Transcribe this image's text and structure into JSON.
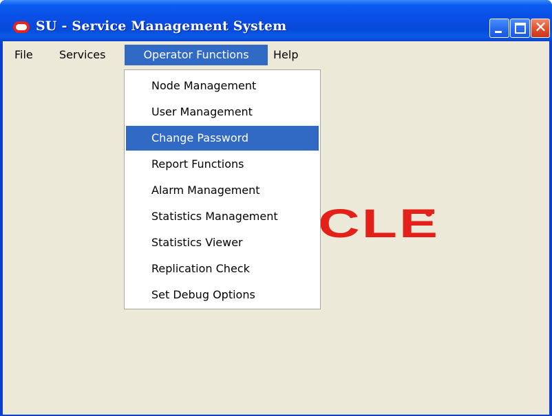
{
  "window": {
    "title": "SU - Service Management System",
    "controls": {
      "minimize_icon": "minimize-icon",
      "maximize_icon": "maximize-icon",
      "close_glyph": "✕"
    }
  },
  "menubar": {
    "items": [
      {
        "label": "File"
      },
      {
        "label": "Services"
      },
      {
        "label": "Operator Functions"
      },
      {
        "label": "Help"
      }
    ]
  },
  "dropdown": {
    "parent": "Operator Functions",
    "selected": "Change Password",
    "items": [
      {
        "label": "Node Management"
      },
      {
        "label": "User Management"
      },
      {
        "label": "Change Password"
      },
      {
        "label": "Report Functions"
      },
      {
        "label": "Alarm Management"
      },
      {
        "label": "Statistics Management"
      },
      {
        "label": "Statistics Viewer"
      },
      {
        "label": "Replication Check"
      },
      {
        "label": "Set Debug Options"
      }
    ]
  },
  "background_logo": {
    "visible_text": "CLE"
  },
  "colors": {
    "titlebar": "#0a4ee4",
    "menu_highlight": "#316ac5",
    "client_bg": "#ece9d8",
    "logo_red": "#e3201a"
  }
}
